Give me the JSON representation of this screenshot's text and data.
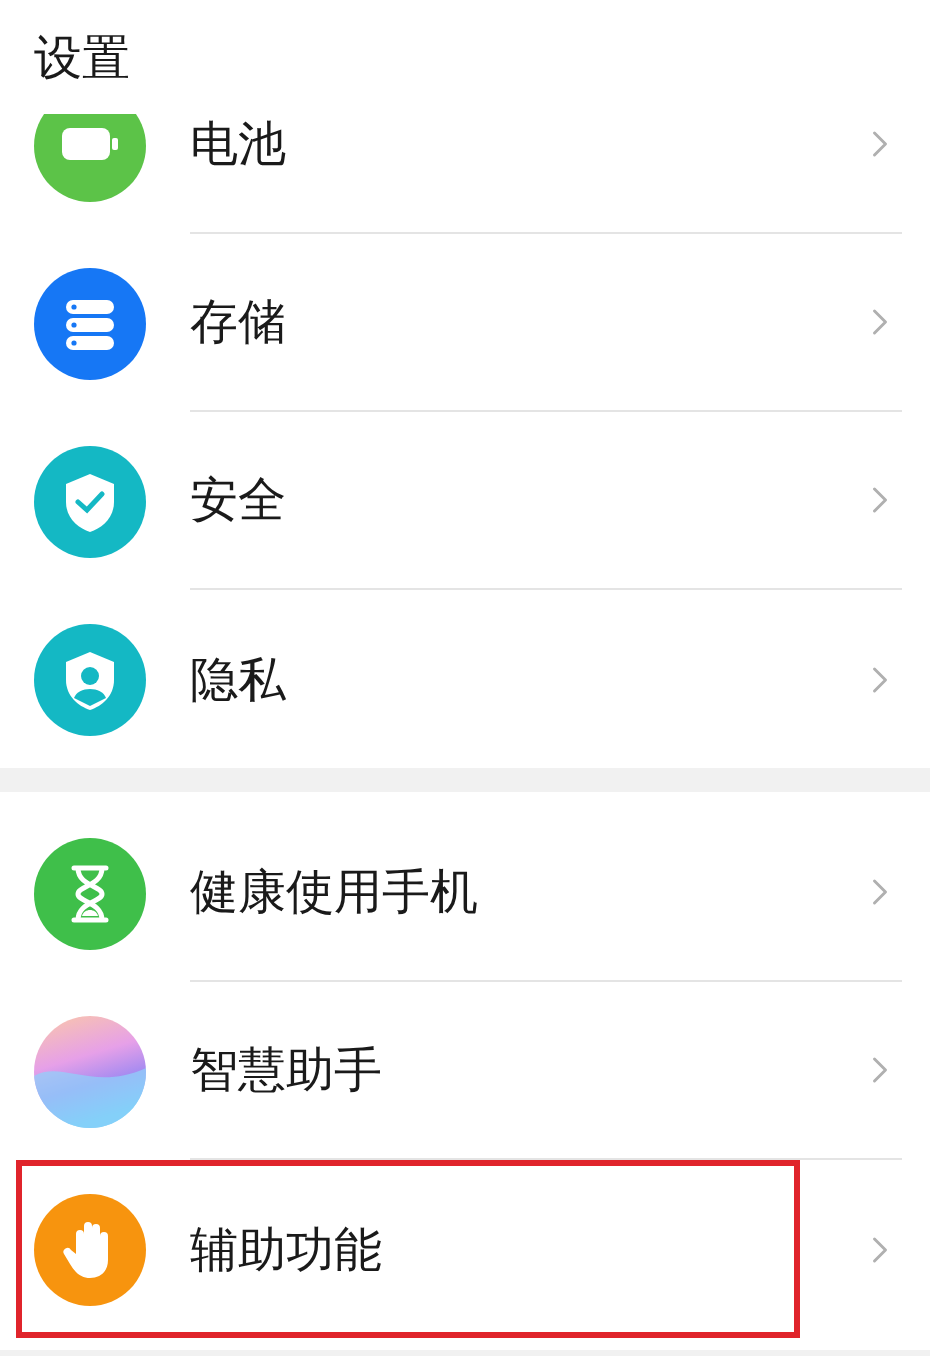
{
  "header": {
    "title": "设置"
  },
  "groups": [
    {
      "items": [
        {
          "label": "电池",
          "kind": "battery",
          "highlighted": false
        },
        {
          "label": "存储",
          "kind": "storage",
          "highlighted": false
        },
        {
          "label": "安全",
          "kind": "security",
          "highlighted": false
        },
        {
          "label": "隐私",
          "kind": "privacy",
          "highlighted": false
        }
      ]
    },
    {
      "items": [
        {
          "label": "健康使用手机",
          "kind": "hourglass",
          "highlighted": false
        },
        {
          "label": "智慧助手",
          "kind": "assistant",
          "highlighted": false
        },
        {
          "label": "辅助功能",
          "kind": "hand",
          "highlighted": true
        }
      ]
    }
  ]
}
